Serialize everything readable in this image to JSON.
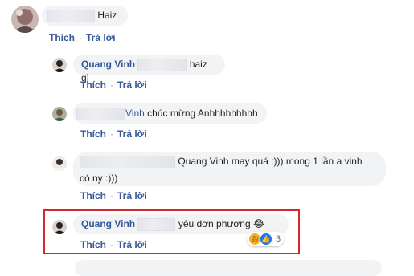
{
  "comments": [
    {
      "author": "",
      "text": "Haiz",
      "actions": {
        "like": "Thích",
        "reply": "Trả lời"
      }
    },
    {
      "author": "Quang Vinh",
      "text": "haiz gì",
      "actions": {
        "like": "Thích",
        "reply": "Trả lời"
      }
    },
    {
      "author": "Vinh",
      "text": "chúc mừng Anhhhhhhhhh",
      "actions": {
        "like": "Thích",
        "reply": "Trả lời"
      }
    },
    {
      "author": "",
      "text_line1": "Quang Vinh may quá :))) mong 1 lần a vinh",
      "text_line2": "có ny :)))",
      "actions": {
        "like": "Thích",
        "reply": "Trả lời"
      }
    },
    {
      "author": "Quang Vinh",
      "text": "yêu đơn phương",
      "emoji": "😂",
      "actions": {
        "like": "Thích",
        "reply": "Trả lời"
      },
      "reactions": {
        "icons": [
          "haha-icon",
          "like-icon"
        ],
        "count": "3"
      }
    }
  ],
  "colors": {
    "highlight": "#d7262c",
    "link": "#385898",
    "bubble": "#f2f3f5"
  }
}
